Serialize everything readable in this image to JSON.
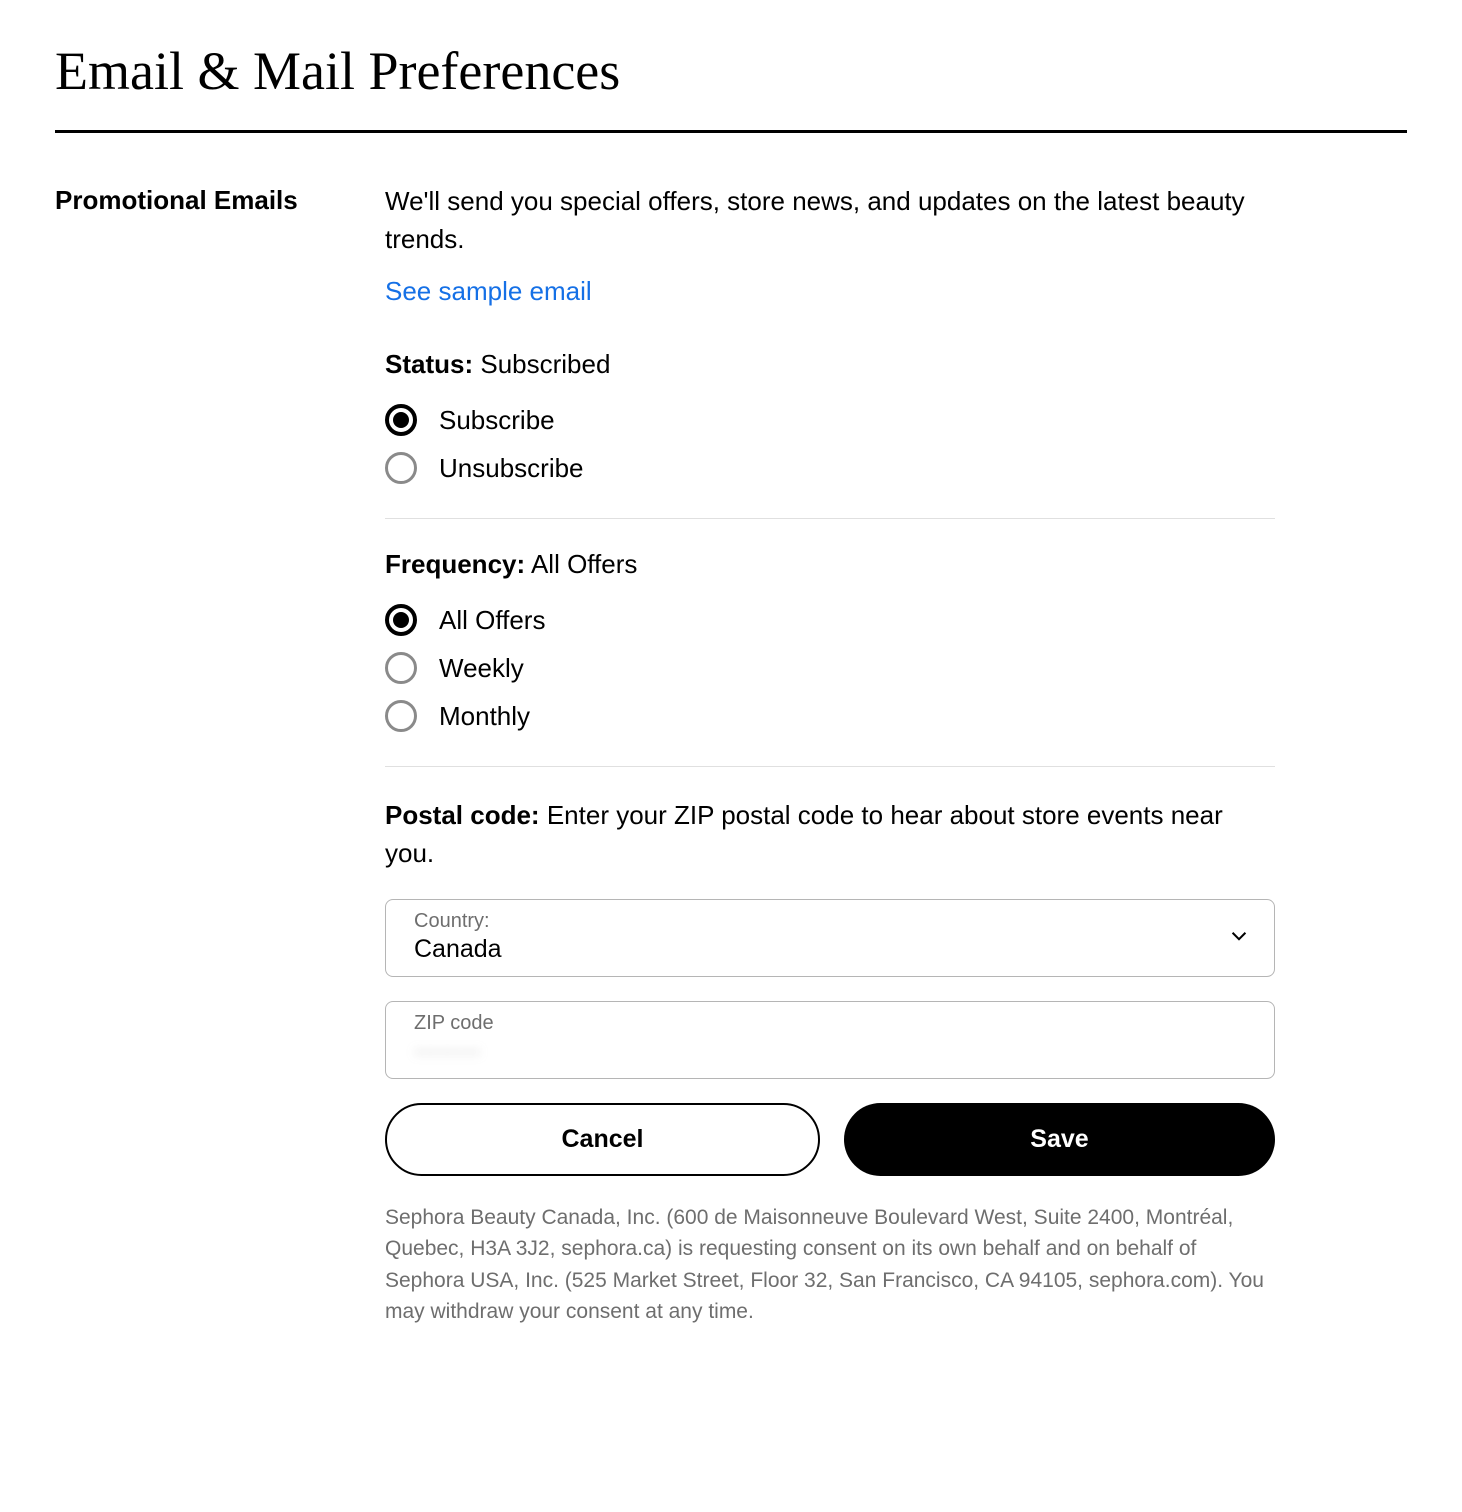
{
  "page_title": "Email & Mail Preferences",
  "section_label": "Promotional Emails",
  "description": "We'll send you special offers, store news, and updates on the latest beauty trends.",
  "sample_link": "See sample email",
  "status": {
    "label": "Status:",
    "value": "Subscribed",
    "options": {
      "subscribe": "Subscribe",
      "unsubscribe": "Unsubscribe"
    }
  },
  "frequency": {
    "label": "Frequency:",
    "value": "All Offers",
    "options": {
      "all": "All Offers",
      "weekly": "Weekly",
      "monthly": "Monthly"
    }
  },
  "postal": {
    "label": "Postal code:",
    "description": "Enter your ZIP postal code to hear about store events near you."
  },
  "country": {
    "label": "Country:",
    "value": "Canada"
  },
  "zip": {
    "label": "ZIP code",
    "value": "········"
  },
  "buttons": {
    "cancel": "Cancel",
    "save": "Save"
  },
  "legal": "Sephora Beauty Canada, Inc. (600 de Maisonneuve Boulevard West, Suite 2400, Montréal, Quebec, H3A 3J2, sephora.ca) is requesting consent on its own behalf and on behalf of Sephora USA, Inc. (525 Market Street, Floor 32, San Francisco, CA 94105, sephora.com). You may withdraw your consent at any time."
}
